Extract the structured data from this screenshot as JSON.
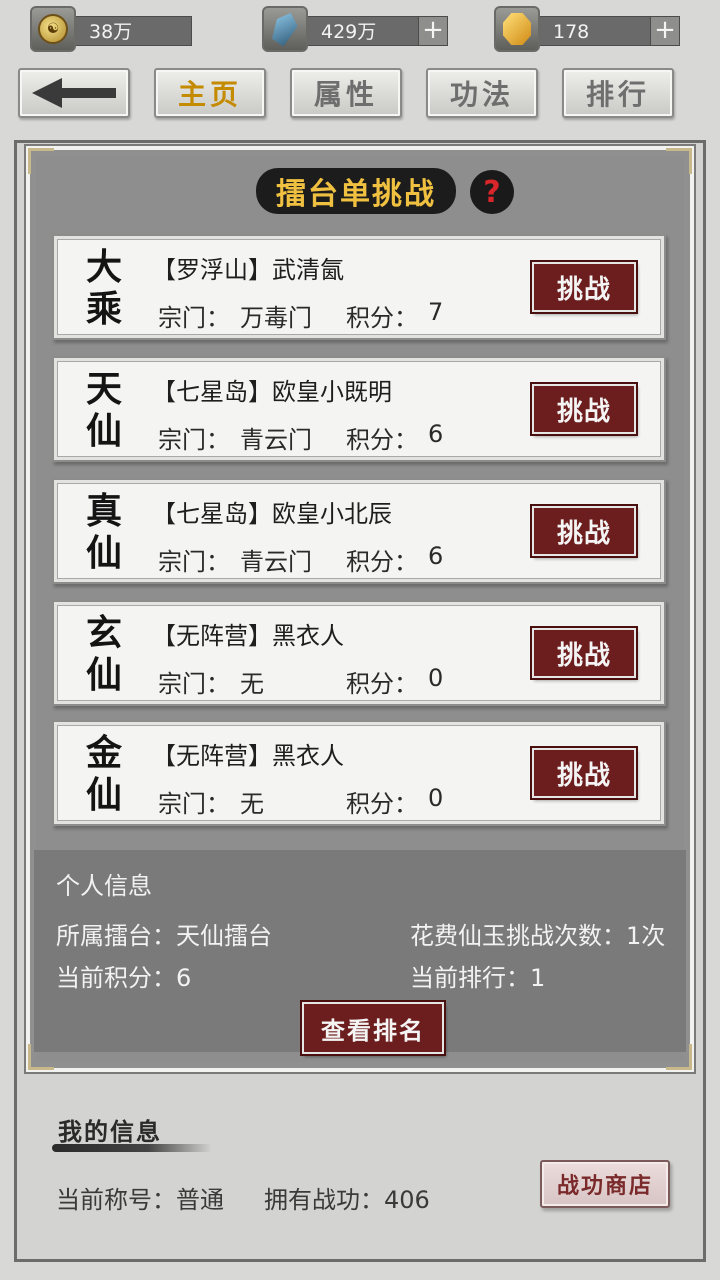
{
  "currencies": [
    {
      "icon": "coin-icon",
      "value": "38万",
      "has_plus": false
    },
    {
      "icon": "crystal-icon",
      "value": "429万",
      "has_plus": true
    },
    {
      "icon": "jade-icon",
      "value": "178",
      "has_plus": true
    }
  ],
  "nav": {
    "back_icon": "back-arrow-icon",
    "tabs": [
      {
        "label": "主页",
        "active": true
      },
      {
        "label": "属性",
        "active": false
      },
      {
        "label": "功法",
        "active": false
      },
      {
        "label": "排行",
        "active": false
      }
    ]
  },
  "panel": {
    "title": "擂台单挑战",
    "help_symbol": "?"
  },
  "challengers": [
    {
      "rank_top": "大",
      "rank_bottom": "乘",
      "name": "【罗浮山】武清氤",
      "sect_label": "宗门：",
      "sect": "万毒门",
      "score_label": "积分：",
      "score": "7",
      "button": "挑战"
    },
    {
      "rank_top": "天",
      "rank_bottom": "仙",
      "name": "【七星岛】欧皇小既明",
      "sect_label": "宗门：",
      "sect": "青云门",
      "score_label": "积分：",
      "score": "6",
      "button": "挑战"
    },
    {
      "rank_top": "真",
      "rank_bottom": "仙",
      "name": "【七星岛】欧皇小北辰",
      "sect_label": "宗门：",
      "sect": "青云门",
      "score_label": "积分：",
      "score": "6",
      "button": "挑战"
    },
    {
      "rank_top": "玄",
      "rank_bottom": "仙",
      "name": "【无阵营】黑衣人",
      "sect_label": "宗门：",
      "sect": "无",
      "score_label": "积分：",
      "score": "0",
      "button": "挑战"
    },
    {
      "rank_top": "金",
      "rank_bottom": "仙",
      "name": "【无阵营】黑衣人",
      "sect_label": "宗门：",
      "sect": "无",
      "score_label": "积分：",
      "score": "0",
      "button": "挑战"
    }
  ],
  "personal": {
    "heading": "个人信息",
    "arena": "所属擂台：天仙擂台",
    "jade_challenges": "花费仙玉挑战次数：1次",
    "current_score": "当前积分：6",
    "current_rank": "当前排行：1",
    "ranking_button": "查看排名"
  },
  "my_info": {
    "heading": "我的信息",
    "title": "当前称号：普通",
    "merit": "拥有战功：406",
    "shop_button": "战功商店"
  }
}
